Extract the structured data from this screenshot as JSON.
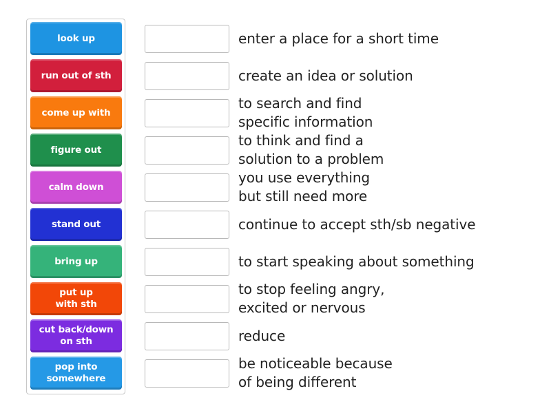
{
  "activity": {
    "type": "match-up",
    "tiles": [
      {
        "label": "look up",
        "color": "#1e94e2"
      },
      {
        "label": "run out of sth",
        "color": "#d21f3c"
      },
      {
        "label": "come up with",
        "color": "#f97a0e"
      },
      {
        "label": "figure out",
        "color": "#1f8f4c"
      },
      {
        "label": "calm down",
        "color": "#cf4fd6"
      },
      {
        "label": "stand out",
        "color": "#2231d3"
      },
      {
        "label": "bring up",
        "color": "#35b37a"
      },
      {
        "label": "put up\nwith sth",
        "color": "#f24708"
      },
      {
        "label": "cut back/down\non sth",
        "color": "#7c2ce0"
      },
      {
        "label": "pop into\nsomewhere",
        "color": "#2599e6"
      }
    ],
    "rows": [
      {
        "answer": "",
        "definition": "enter a place for a short time"
      },
      {
        "answer": "",
        "definition": "create an idea or solution"
      },
      {
        "answer": "",
        "definition": "to search and find\nspecific information"
      },
      {
        "answer": "",
        "definition": "to think and find a\nsolution to a problem"
      },
      {
        "answer": "",
        "definition": "you use everything\nbut still need more"
      },
      {
        "answer": "",
        "definition": "continue to accept sth/sb negative"
      },
      {
        "answer": "",
        "definition": "to start speaking about something"
      },
      {
        "answer": "",
        "definition": "to stop feeling angry,\nexcited or nervous"
      },
      {
        "answer": "",
        "definition": "reduce"
      },
      {
        "answer": "",
        "definition": "be noticeable because\nof being different"
      }
    ]
  }
}
